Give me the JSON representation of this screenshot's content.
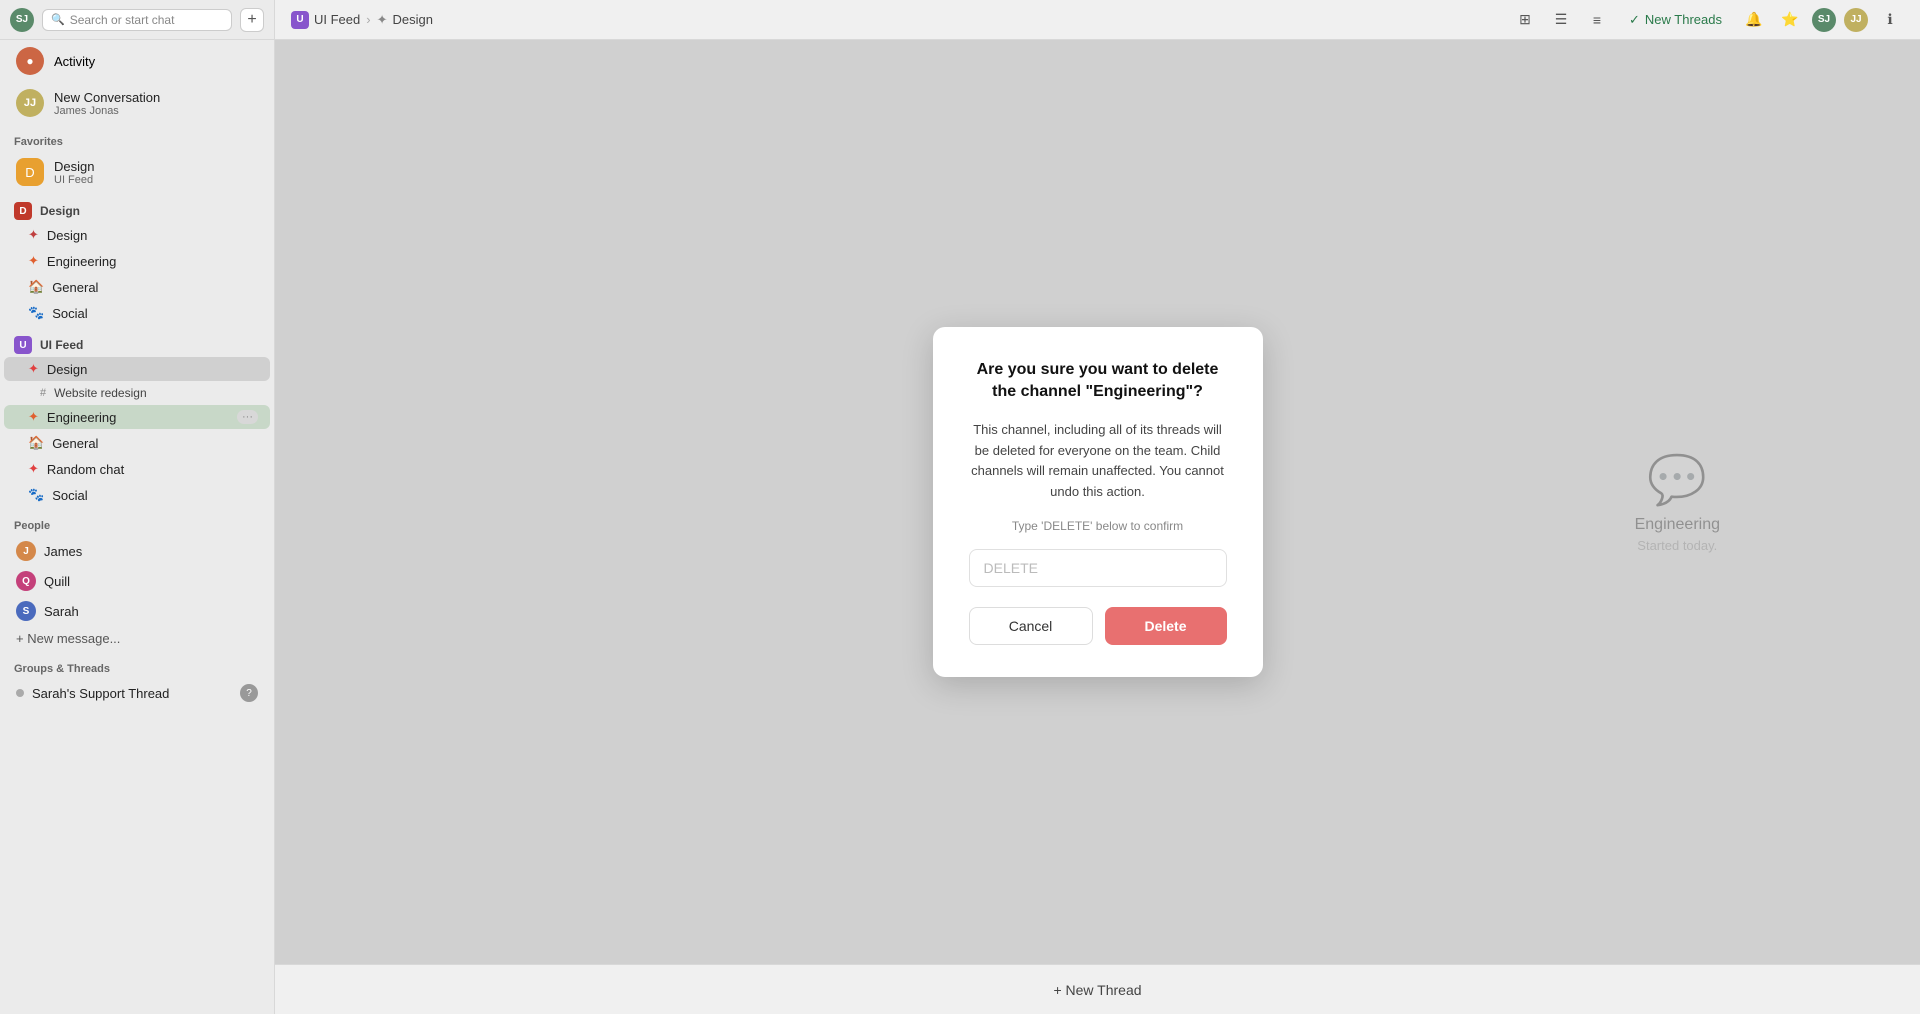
{
  "header": {
    "user_initials": "SJ",
    "search_placeholder": "Search or start chat",
    "add_icon": "+",
    "breadcrumb": {
      "feed_icon_label": "U",
      "feed_name": "UI Feed",
      "separator": "›",
      "channel_icon_label": "✦",
      "channel_name": "Design"
    },
    "topbar_icons": [
      "grid-icon",
      "list-icon",
      "menu-icon"
    ],
    "new_threads_label": "New Threads",
    "topbar_avatars": [
      "SJ",
      "JJ"
    ]
  },
  "sidebar": {
    "activity_label": "Activity",
    "activity_icon": "●",
    "new_conversation": {
      "title": "New Conversation",
      "subtitle": "James Jonas",
      "avatar": "JJ"
    },
    "favorites_label": "Favorites",
    "favorites": [
      {
        "name": "Design",
        "subtitle": "UI Feed",
        "icon": "D",
        "color": "#e8a030"
      }
    ],
    "channel_groups": [
      {
        "name": "Design",
        "icon": "D",
        "color": "#c0392b",
        "channels": [
          {
            "name": "Design",
            "icon": "✦",
            "color": "#c04040",
            "active": false
          },
          {
            "name": "Engineering",
            "icon": "✦",
            "color": "#e06030",
            "active": false
          },
          {
            "name": "General",
            "icon": "🏠",
            "active": false
          },
          {
            "name": "Social",
            "icon": "🐾",
            "active": false
          }
        ]
      },
      {
        "name": "UI Feed",
        "icon": "U",
        "color": "#8855cc",
        "channels": [
          {
            "name": "Design",
            "icon": "✦",
            "color": "#e04040",
            "active": true
          },
          {
            "name": "Engineering",
            "icon": "✦",
            "color": "#e06030",
            "active": true,
            "has_submenu": true,
            "badge": "···"
          },
          {
            "name": "General",
            "icon": "🏠",
            "active": false
          },
          {
            "name": "Random chat",
            "icon": "✦",
            "color": "#e04040",
            "active": false
          },
          {
            "name": "Social",
            "icon": "🐾",
            "active": false
          }
        ],
        "subchannels": [
          {
            "name": "Website redesign",
            "icon": "#"
          }
        ]
      }
    ],
    "people_label": "People",
    "people": [
      {
        "name": "James",
        "avatar": "J",
        "color": "#d4884a"
      },
      {
        "name": "Quill",
        "avatar": "Q",
        "color": "#c4407a"
      },
      {
        "name": "Sarah",
        "avatar": "S",
        "color": "#4a6abd"
      }
    ],
    "new_message_label": "+ New message...",
    "groups_threads_label": "Groups & Threads",
    "threads": [
      {
        "name": "Sarah's Support Thread",
        "has_badge": true,
        "badge": "?"
      }
    ]
  },
  "modal": {
    "title": "Are you sure you want to delete the channel \"Engineering\"?",
    "description": "This channel, including all of its threads will be deleted for everyone on the team. Child channels will remain unaffected. You cannot undo this action.",
    "confirm_label": "Type 'DELETE' below to confirm",
    "input_placeholder": "DELETE",
    "cancel_label": "Cancel",
    "delete_label": "Delete"
  },
  "bottom_bar": {
    "new_thread_label": "+ New Thread"
  }
}
